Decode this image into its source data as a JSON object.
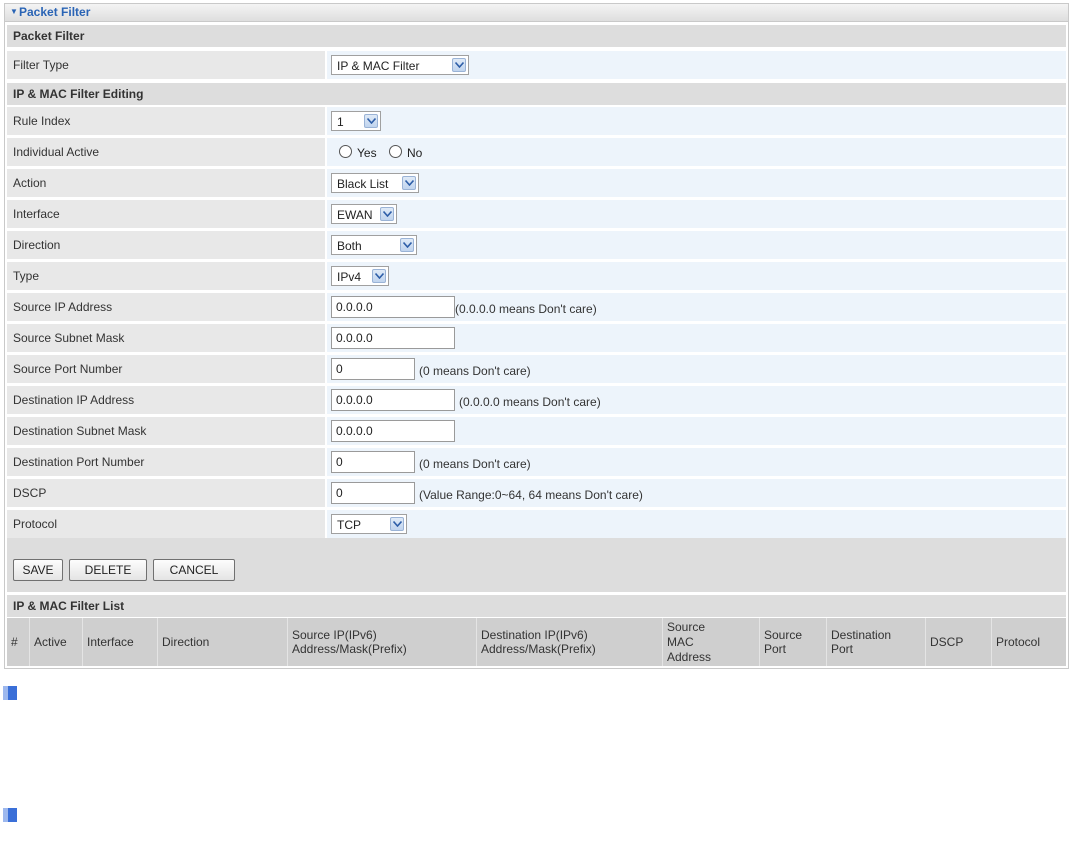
{
  "panel_title": "Packet Filter",
  "section_packet_filter": "Packet Filter",
  "filter_type": {
    "label": "Filter Type",
    "value": "IP & MAC Filter"
  },
  "section_editing": "IP & MAC Filter Editing",
  "rule_index": {
    "label": "Rule Index",
    "value": "1"
  },
  "individual_active": {
    "label": "Individual Active",
    "yes": "Yes",
    "no": "No"
  },
  "action": {
    "label": "Action",
    "value": "Black List"
  },
  "interface": {
    "label": "Interface",
    "value": "EWAN"
  },
  "direction": {
    "label": "Direction",
    "value": "Both"
  },
  "type": {
    "label": "Type",
    "value": "IPv4"
  },
  "source_ip": {
    "label": "Source IP Address",
    "value": "0.0.0.0",
    "hint": "(0.0.0.0 means Don't care)"
  },
  "source_mask": {
    "label": "Source Subnet Mask",
    "value": "0.0.0.0"
  },
  "source_port": {
    "label": "Source Port Number",
    "value": "0",
    "hint": "(0 means Don't care)"
  },
  "dest_ip": {
    "label": "Destination IP Address",
    "value": "0.0.0.0",
    "hint": "(0.0.0.0 means Don't care)"
  },
  "dest_mask": {
    "label": "Destination Subnet Mask",
    "value": "0.0.0.0"
  },
  "dest_port": {
    "label": "Destination Port Number",
    "value": "0",
    "hint": "(0 means Don't care)"
  },
  "dscp": {
    "label": "DSCP",
    "value": "0",
    "hint": "(Value Range:0~64, 64 means Don't care)"
  },
  "protocol": {
    "label": "Protocol",
    "value": "TCP"
  },
  "buttons": {
    "save": "SAVE",
    "delete": "DELETE",
    "cancel": "CANCEL"
  },
  "section_list": "IP & MAC Filter List",
  "list_columns": {
    "num": "#",
    "active": "Active",
    "interface": "Interface",
    "direction": "Direction",
    "source_ip_1": "Source IP(IPv6)",
    "source_ip_2": "Address/Mask(Prefix)",
    "dest_ip_1": "Destination IP(IPv6)",
    "dest_ip_2": "Address/Mask(Prefix)",
    "smac_1": "Source",
    "smac_2": "MAC",
    "smac_3": "Address",
    "sport_1": "Source",
    "sport_2": "Port",
    "dport_1": "Destination",
    "dport_2": "Port",
    "dscp": "DSCP",
    "protocol": "Protocol"
  },
  "colors": {
    "title_blue": "#2a64b5",
    "value_bg": "#edf4fb",
    "label_bg": "#e8e8e8",
    "bullet": "#3a6fd8"
  },
  "icons": [
    "triangle-down-icon",
    "chevron-down-icon",
    "bullet-square-icon"
  ]
}
